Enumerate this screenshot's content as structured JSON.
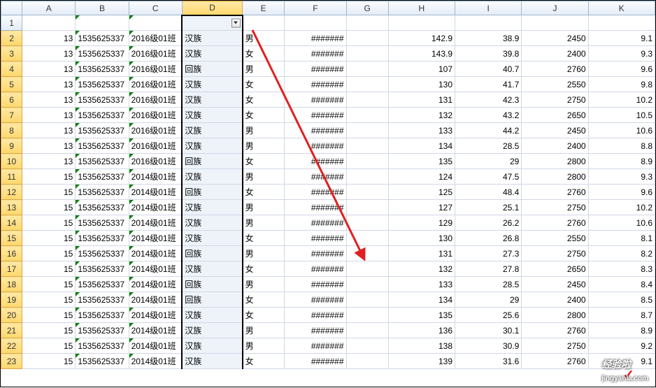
{
  "columns": [
    "A",
    "B",
    "C",
    "D",
    "E",
    "F",
    "G",
    "H",
    "I",
    "J",
    "K"
  ],
  "selected_col_index": 3,
  "watermark": "经验啦",
  "watermark_url": "jingyanla.com",
  "rows": [
    {
      "n": 1,
      "A": "",
      "B": "",
      "C": "",
      "D": "",
      "E": "",
      "F": "",
      "G": "",
      "H": "",
      "I": "",
      "J": "",
      "K": ""
    },
    {
      "n": 2,
      "A": "13",
      "B": "1535625337",
      "C": "2016级01班",
      "D": "汉族",
      "E": "男",
      "F": "#######",
      "G": "",
      "H": "142.9",
      "I": "38.9",
      "J": "2450",
      "K": "9.1"
    },
    {
      "n": 3,
      "A": "13",
      "B": "1535625337",
      "C": "2016级01班",
      "D": "汉族",
      "E": "女",
      "F": "#######",
      "G": "",
      "H": "143.9",
      "I": "39.8",
      "J": "2400",
      "K": "9.3"
    },
    {
      "n": 4,
      "A": "13",
      "B": "1535625337",
      "C": "2016级01班",
      "D": "回族",
      "E": "男",
      "F": "#######",
      "G": "",
      "H": "107",
      "I": "40.7",
      "J": "2760",
      "K": "9.6"
    },
    {
      "n": 5,
      "A": "13",
      "B": "1535625337",
      "C": "2016级01班",
      "D": "汉族",
      "E": "女",
      "F": "#######",
      "G": "",
      "H": "130",
      "I": "41.7",
      "J": "2550",
      "K": "9.8"
    },
    {
      "n": 6,
      "A": "13",
      "B": "1535625337",
      "C": "2016级01班",
      "D": "汉族",
      "E": "女",
      "F": "#######",
      "G": "",
      "H": "131",
      "I": "42.3",
      "J": "2750",
      "K": "10.2"
    },
    {
      "n": 7,
      "A": "13",
      "B": "1535625337",
      "C": "2016级01班",
      "D": "汉族",
      "E": "女",
      "F": "#######",
      "G": "",
      "H": "132",
      "I": "43.2",
      "J": "2650",
      "K": "10.5"
    },
    {
      "n": 8,
      "A": "13",
      "B": "1535625337",
      "C": "2016级01班",
      "D": "汉族",
      "E": "男",
      "F": "#######",
      "G": "",
      "H": "133",
      "I": "44.2",
      "J": "2450",
      "K": "10.6"
    },
    {
      "n": 9,
      "A": "13",
      "B": "1535625337",
      "C": "2016级01班",
      "D": "汉族",
      "E": "男",
      "F": "#######",
      "G": "",
      "H": "134",
      "I": "28.5",
      "J": "2400",
      "K": "8.8"
    },
    {
      "n": 10,
      "A": "13",
      "B": "1535625337",
      "C": "2016级01班",
      "D": "回族",
      "E": "女",
      "F": "#######",
      "G": "",
      "H": "135",
      "I": "29",
      "J": "2800",
      "K": "8.9"
    },
    {
      "n": 11,
      "A": "15",
      "B": "1535625337",
      "C": "2014级01班",
      "D": "汉族",
      "E": "男",
      "F": "#######",
      "G": "",
      "H": "124",
      "I": "47.5",
      "J": "2800",
      "K": "9.3"
    },
    {
      "n": 12,
      "A": "15",
      "B": "1535625337",
      "C": "2014级01班",
      "D": "回族",
      "E": "女",
      "F": "#######",
      "G": "",
      "H": "125",
      "I": "48.4",
      "J": "2760",
      "K": "9.6"
    },
    {
      "n": 13,
      "A": "15",
      "B": "1535625337",
      "C": "2014级01班",
      "D": "汉族",
      "E": "男",
      "F": "#######",
      "G": "",
      "H": "127",
      "I": "25.1",
      "J": "2750",
      "K": "10.2"
    },
    {
      "n": 14,
      "A": "15",
      "B": "1535625337",
      "C": "2014级01班",
      "D": "汉族",
      "E": "男",
      "F": "#######",
      "G": "",
      "H": "129",
      "I": "26.2",
      "J": "2760",
      "K": "10.6"
    },
    {
      "n": 15,
      "A": "15",
      "B": "1535625337",
      "C": "2014级01班",
      "D": "汉族",
      "E": "女",
      "F": "#######",
      "G": "",
      "H": "130",
      "I": "26.8",
      "J": "2550",
      "K": "8.1"
    },
    {
      "n": 16,
      "A": "15",
      "B": "1535625337",
      "C": "2014级01班",
      "D": "回族",
      "E": "男",
      "F": "#######",
      "G": "",
      "H": "131",
      "I": "27.3",
      "J": "2750",
      "K": "8.2"
    },
    {
      "n": 17,
      "A": "15",
      "B": "1535625337",
      "C": "2014级01班",
      "D": "汉族",
      "E": "女",
      "F": "#######",
      "G": "",
      "H": "132",
      "I": "27.8",
      "J": "2650",
      "K": "8.3"
    },
    {
      "n": 18,
      "A": "15",
      "B": "1535625337",
      "C": "2014级01班",
      "D": "回族",
      "E": "男",
      "F": "#######",
      "G": "",
      "H": "133",
      "I": "28.5",
      "J": "2450",
      "K": "8.4"
    },
    {
      "n": 19,
      "A": "15",
      "B": "1535625337",
      "C": "2014级01班",
      "D": "回族",
      "E": "女",
      "F": "#######",
      "G": "",
      "H": "134",
      "I": "29",
      "J": "2400",
      "K": "8.5"
    },
    {
      "n": 20,
      "A": "15",
      "B": "1535625337",
      "C": "2014级01班",
      "D": "汉族",
      "E": "女",
      "F": "#######",
      "G": "",
      "H": "135",
      "I": "25.6",
      "J": "2800",
      "K": "8.7"
    },
    {
      "n": 21,
      "A": "15",
      "B": "1535625337",
      "C": "2014级01班",
      "D": "汉族",
      "E": "男",
      "F": "#######",
      "G": "",
      "H": "136",
      "I": "30.1",
      "J": "2760",
      "K": "8.9"
    },
    {
      "n": 22,
      "A": "15",
      "B": "1535625337",
      "C": "2014级01班",
      "D": "汉族",
      "E": "男",
      "F": "#######",
      "G": "",
      "H": "138",
      "I": "30.9",
      "J": "2750",
      "K": "9.2"
    },
    {
      "n": 23,
      "A": "15",
      "B": "1535625337",
      "C": "2014级01班",
      "D": "汉族",
      "E": "女",
      "F": "#######",
      "G": "",
      "H": "139",
      "I": "31.6",
      "J": "2760",
      "K": "9.1"
    }
  ],
  "col_widths": {
    "rowhdr": 30,
    "A": 76,
    "B": 76,
    "C": 76,
    "D": 86,
    "E": 60,
    "F": 88,
    "G": 60,
    "H": 95,
    "I": 95,
    "J": 95,
    "K": 95
  }
}
